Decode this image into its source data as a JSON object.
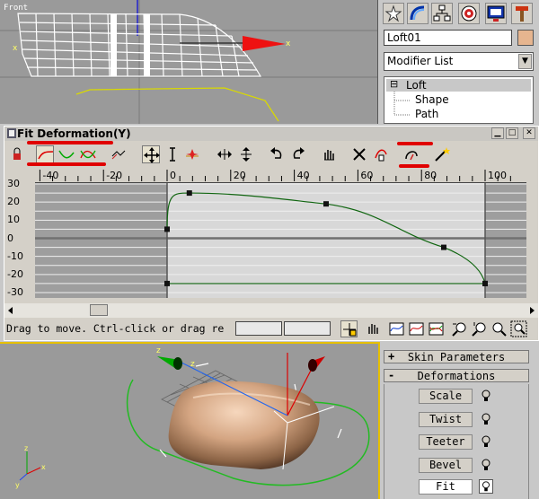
{
  "viewport_front": {
    "label": "Front"
  },
  "command_panel": {
    "object_name": "Loft01",
    "object_color": "#e6b58f",
    "modifier_list": "Modifier List",
    "stack": [
      {
        "label": "Loft",
        "expander": "⊟"
      },
      {
        "label": "Shape"
      },
      {
        "label": "Path"
      }
    ]
  },
  "fit_window": {
    "title": "Fit Deformation(Y)",
    "ruler_ticks": [
      "-40",
      "-20",
      "0",
      "20",
      "40",
      "60",
      "80",
      "100"
    ],
    "y_ticks": [
      "30",
      "20",
      "10",
      "0",
      "-10",
      "-20",
      "-30"
    ],
    "status_text": "Drag to move. Ctrl-click or drag re"
  },
  "chart_data": {
    "type": "line",
    "xlim": [
      -40,
      100
    ],
    "ylim": [
      -30,
      30
    ],
    "series": [
      {
        "values": [
          [
            0,
            5
          ],
          [
            7,
            25
          ],
          [
            50,
            19
          ],
          [
            87,
            -5
          ],
          [
            100,
            -25
          ]
        ]
      },
      {
        "values": [
          [
            0,
            -25
          ],
          [
            100,
            -25
          ]
        ]
      }
    ]
  },
  "rollouts": {
    "skin_parameters": {
      "sign": "+",
      "label": "Skin Parameters"
    },
    "deformations": {
      "sign": "-",
      "label": "Deformations"
    },
    "buttons": [
      {
        "label": "Scale"
      },
      {
        "label": "Twist"
      },
      {
        "label": "Teeter"
      },
      {
        "label": "Bevel"
      },
      {
        "label": "Fit"
      }
    ]
  }
}
